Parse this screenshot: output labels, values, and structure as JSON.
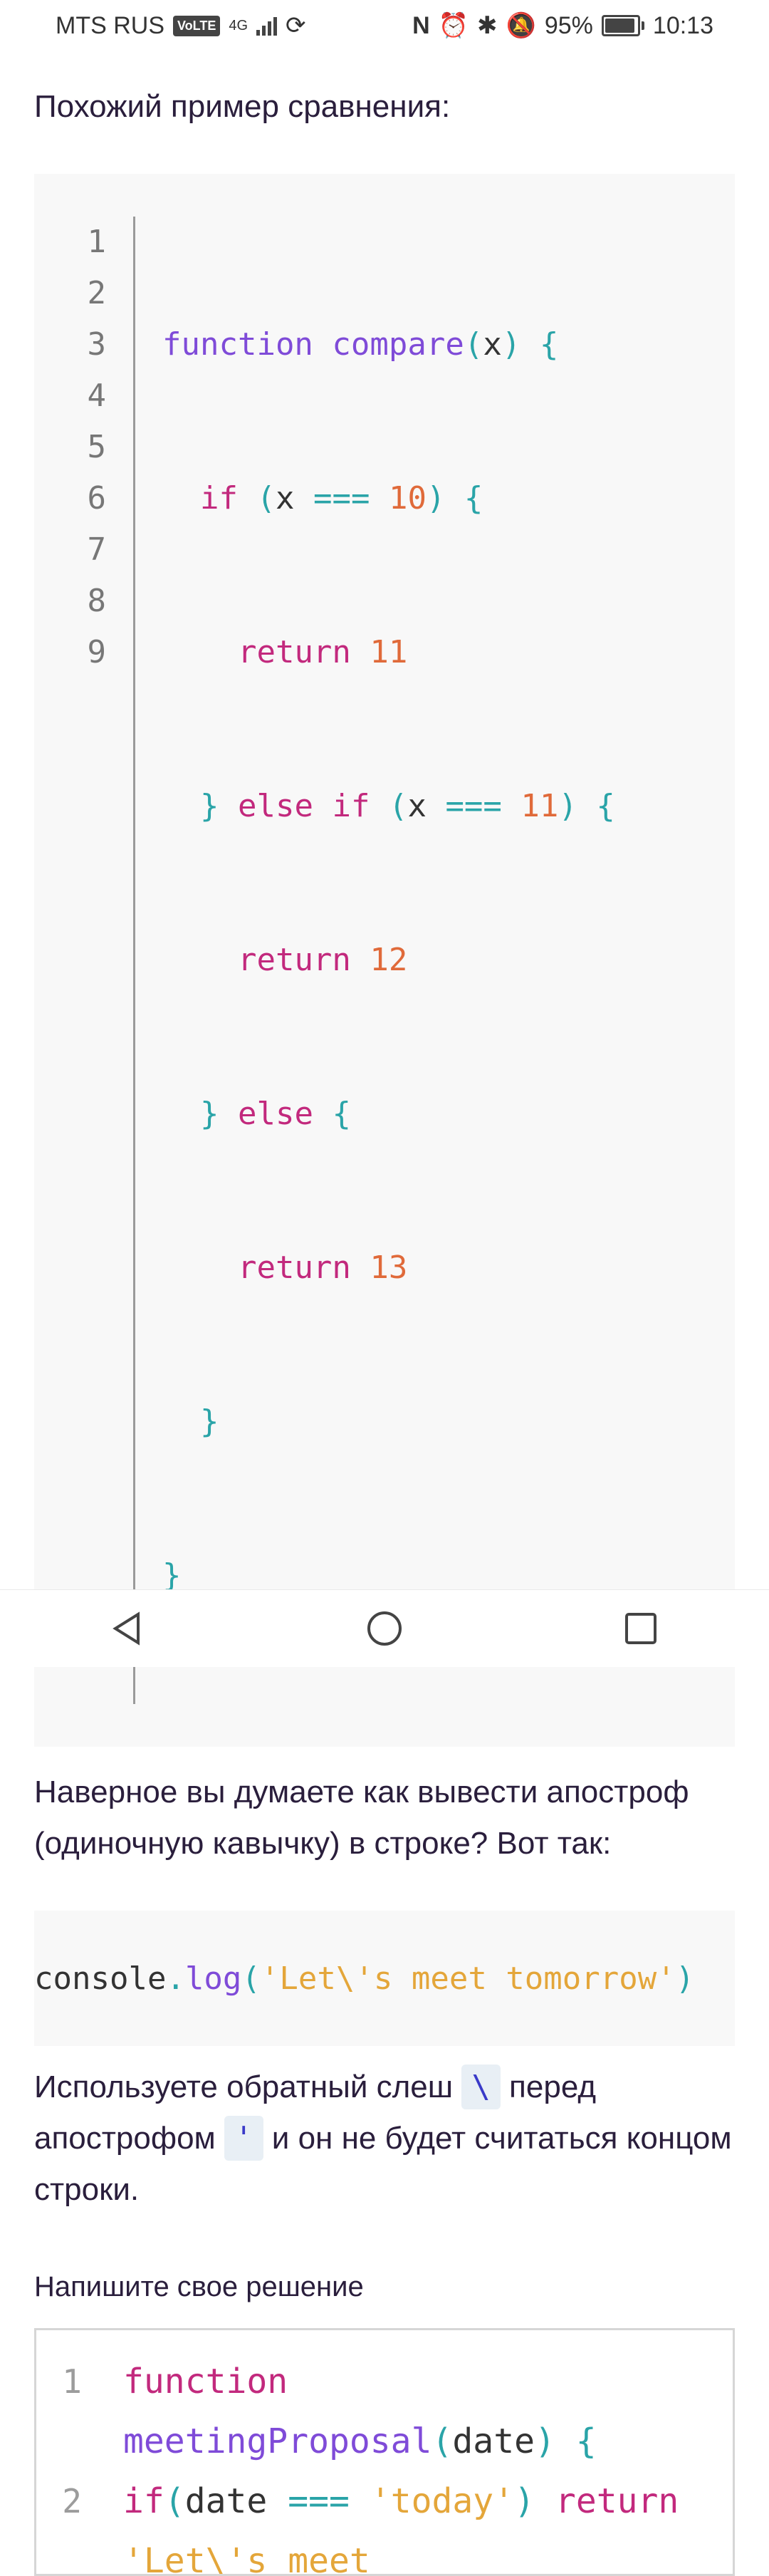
{
  "status_bar": {
    "carrier": "MTS RUS",
    "volte": "VoLTE",
    "network": "4G",
    "battery": "95%",
    "time": "10:13"
  },
  "content": {
    "heading1": "Похожий пример сравнения:",
    "code_block1": {
      "lines": [
        {
          "n": "1"
        },
        {
          "n": "2"
        },
        {
          "n": "3"
        },
        {
          "n": "4"
        },
        {
          "n": "5"
        },
        {
          "n": "6"
        },
        {
          "n": "7"
        },
        {
          "n": "8"
        },
        {
          "n": "9"
        }
      ],
      "tokens": {
        "l1_fn": "function",
        "l1_name": "compare",
        "l1_paren_open": "(",
        "l1_arg": "x",
        "l1_rest": ") {",
        "l2_if": "if",
        "l2_open": "(",
        "l2_x": "x",
        "l2_eq": "===",
        "l2_num": "10",
        "l2_close": ") {",
        "l3_ret": "return",
        "l3_num": "11",
        "l4_brace": "}",
        "l4_else": "else",
        "l4_if": "if",
        "l4_open": "(",
        "l4_x": "x",
        "l4_eq": "===",
        "l4_num": "11",
        "l4_close": ") {",
        "l5_ret": "return",
        "l5_num": "12",
        "l6_brace": "}",
        "l6_else": "else",
        "l6_open": "{",
        "l7_ret": "return",
        "l7_num": "13",
        "l8_brace": "}",
        "l9_brace": "}"
      }
    },
    "paragraph1": "Наверное вы думаете как вывести апостроф (одиночную кавычку) в строке? Вот так:",
    "code_block2": {
      "obj": "console",
      "dot": ".",
      "method": "log",
      "open": "(",
      "str": "'Let\\'s meet tomorrow'",
      "close": ")"
    },
    "paragraph2": {
      "part1": "Используете обратный слеш",
      "code1": "\\",
      "part2": "перед апострофом",
      "code2": "'",
      "part3": "и он не будет считаться концом строки."
    },
    "solution_title": "Напишите свое решение",
    "editor": {
      "line1_num": "1",
      "line1_kw": "function",
      "line1_name": "meetingProposal",
      "line1_open": "(",
      "line1_arg": "date",
      "line1_close": ") {",
      "line2_num": "2",
      "line2_if": "if",
      "line2_open": "(",
      "line2_arg": "date",
      "line2_eq": "===",
      "line2_str": "'today'",
      "line2_close": ")",
      "line3_ret": "return",
      "line3_str": "'Let\\'s meet"
    }
  },
  "nav": {
    "back": "back-icon",
    "home": "home-icon",
    "recents": "recents-icon"
  }
}
